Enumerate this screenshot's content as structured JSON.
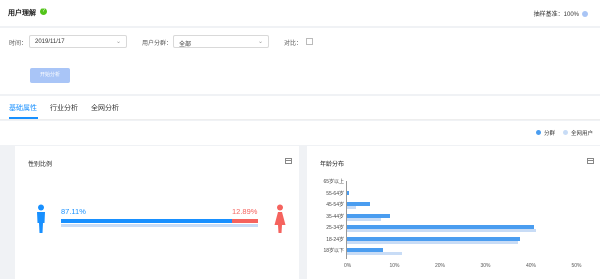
{
  "header": {
    "title": "用户理解",
    "help_icon": "question-circle-icon",
    "sampling_label": "抽样基准：100%"
  },
  "filters": {
    "time_label": "时间：",
    "time_value": "2019/11/17",
    "group_label": "用户分群：",
    "group_value": "全部",
    "compare_label": "对比：",
    "start_button": "开始分析"
  },
  "tabs": [
    "基础属性",
    "行业分析",
    "全网分析"
  ],
  "legend": {
    "group": "分群",
    "all": "全网用户",
    "colors": {
      "group": "#4a9df0",
      "all": "#c8dcf6"
    }
  },
  "gender_card": {
    "title": "性别比例",
    "male_pct": "87.11%",
    "female_pct": "12.89%",
    "male_value": 87.11,
    "female_value": 12.89,
    "male_color": "#1890ff",
    "female_color": "#f5635e"
  },
  "age_card": {
    "title": "年龄分布"
  },
  "chart_data": {
    "type": "bar",
    "orientation": "horizontal",
    "title": "年龄分布",
    "categories": [
      "65岁以上",
      "55-64岁",
      "45-54岁",
      "35-44岁",
      "25-34岁",
      "18-24岁",
      "18岁以下"
    ],
    "series": [
      {
        "name": "分群",
        "values": [
          0,
          0.5,
          5,
          9.5,
          41,
          38,
          8
        ]
      },
      {
        "name": "全网用户",
        "values": [
          0,
          0,
          2,
          7.5,
          41.5,
          37.5,
          12
        ]
      }
    ],
    "xlim": [
      0,
      50
    ],
    "xticks": [
      "0%",
      "10%",
      "20%",
      "30%",
      "40%",
      "50%"
    ],
    "legend": "top-right"
  }
}
